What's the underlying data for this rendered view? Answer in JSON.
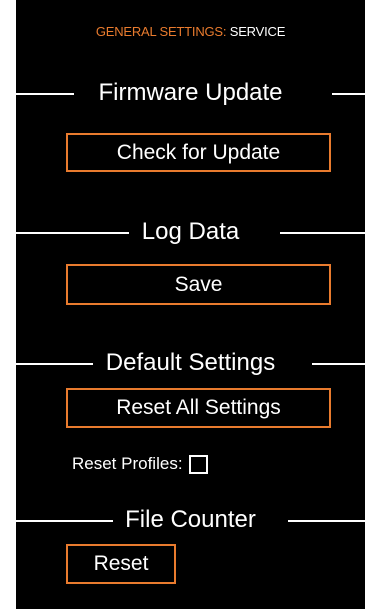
{
  "header": {
    "prefix": "GENERAL SETTINGS:",
    "page": "SERVICE"
  },
  "firmware_update": {
    "title": "Firmware Update",
    "button_label": "Check for Update"
  },
  "log_data": {
    "title": "Log Data",
    "button_label": "Save"
  },
  "default_settings": {
    "title": "Default Settings",
    "button_label": "Reset All Settings",
    "reset_profiles_label": "Reset Profiles:",
    "reset_profiles_checked": false
  },
  "file_counter": {
    "title": "File Counter",
    "button_label": "Reset"
  },
  "colors": {
    "background": "#000000",
    "accent": "#e97b2e",
    "text": "#ffffff"
  }
}
